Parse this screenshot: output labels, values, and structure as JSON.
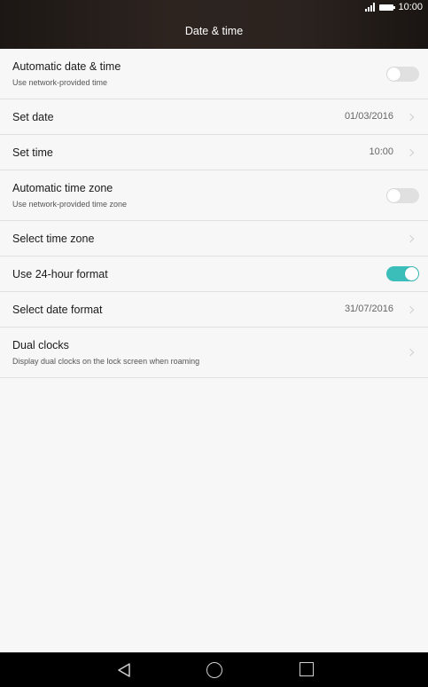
{
  "status_bar": {
    "time": "10:00",
    "signal_icon": "signal-icon",
    "battery_icon": "battery-icon"
  },
  "header": {
    "title": "Date & time"
  },
  "settings": {
    "auto_date_time": {
      "label": "Automatic date & time",
      "sub": "Use network-provided time",
      "enabled": false
    },
    "set_date": {
      "label": "Set date",
      "value": "01/03/2016"
    },
    "set_time": {
      "label": "Set time",
      "value": "10:00"
    },
    "auto_time_zone": {
      "label": "Automatic time zone",
      "sub": "Use network-provided time zone",
      "enabled": false
    },
    "select_time_zone": {
      "label": "Select time zone"
    },
    "use_24_hour": {
      "label": "Use 24-hour format",
      "enabled": true
    },
    "select_date_format": {
      "label": "Select date format",
      "value": "31/07/2016"
    },
    "dual_clocks": {
      "label": "Dual clocks",
      "sub": "Display dual clocks on the lock screen when roaming"
    }
  },
  "nav_bar": {
    "back_icon": "back-icon",
    "home_icon": "home-icon",
    "recents_icon": "recents-icon"
  },
  "colors": {
    "accent": "#3bbdb9",
    "header_bg": "#2b231f",
    "background": "#f7f7f7"
  }
}
